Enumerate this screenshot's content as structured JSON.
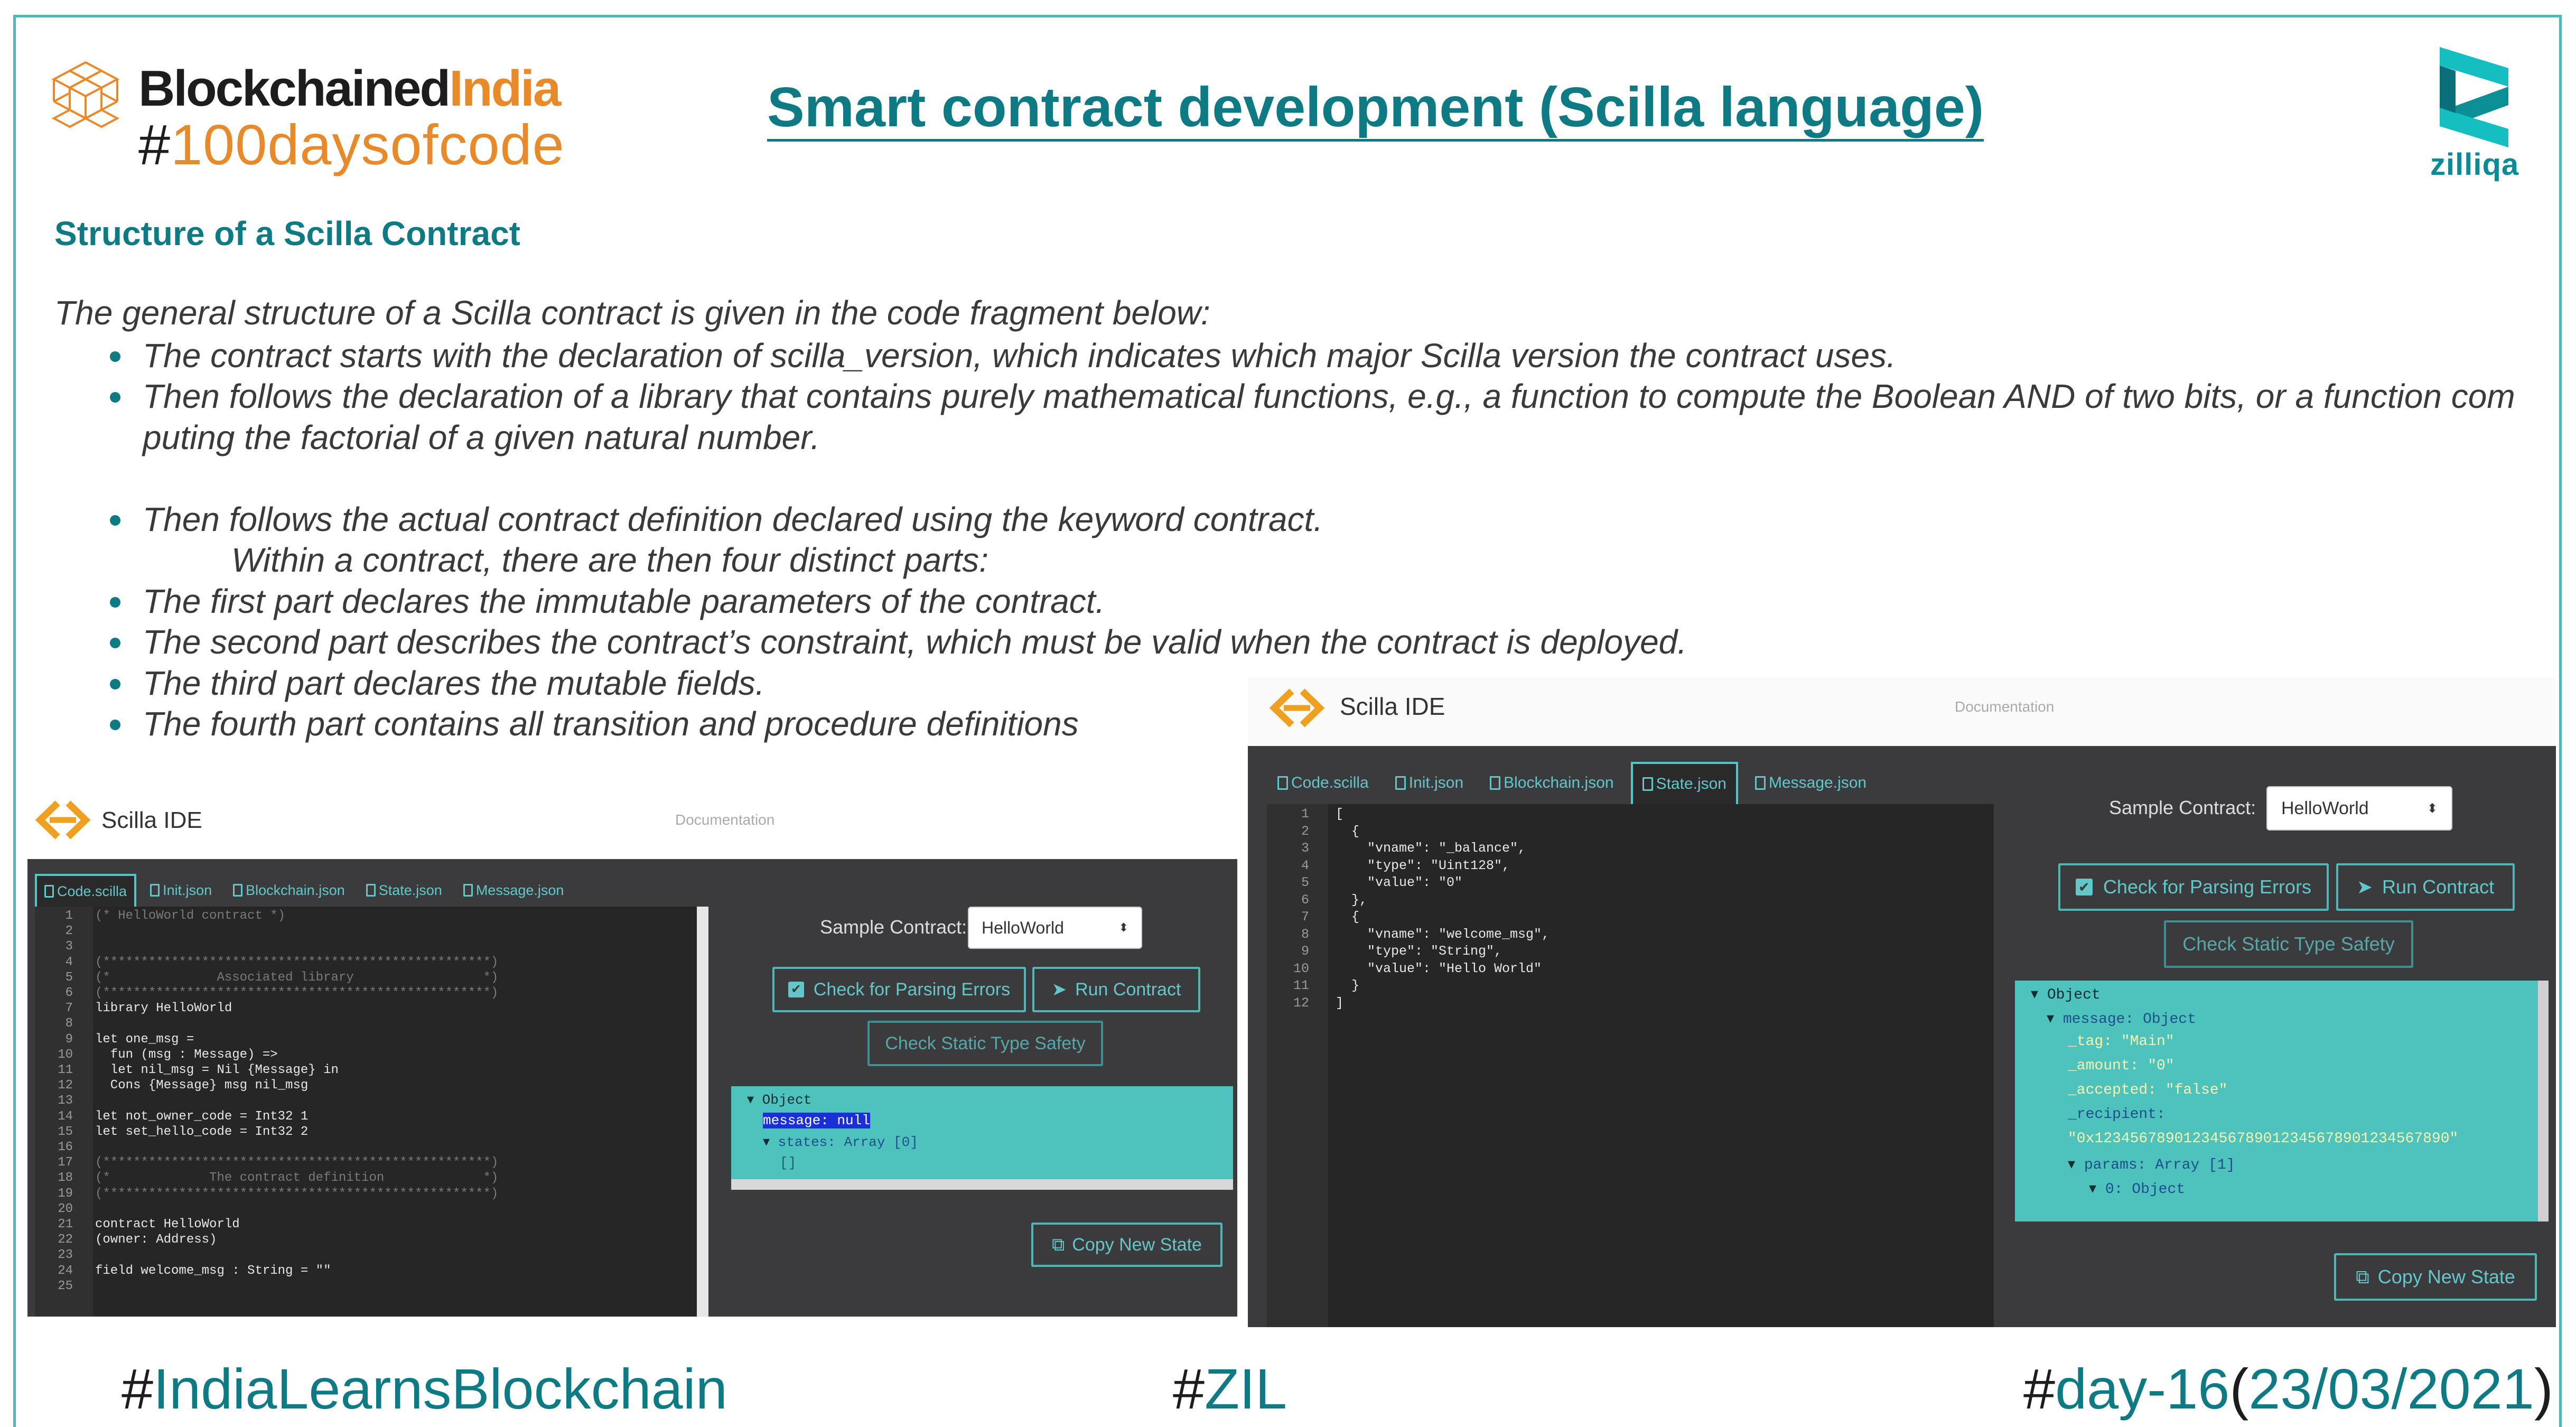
{
  "header": {
    "brand_name_dark": "Blockchained",
    "brand_name_accent": "India",
    "brand_hashtag_symbol": "#",
    "brand_hashtag_text": "100daysofcode",
    "title": "Smart contract development (Scilla language)",
    "partner_logo_text": "zilliqa"
  },
  "content": {
    "section_title": "Structure of a Scilla Contract",
    "intro": "The general structure of a Scilla contract is given in the code fragment below:",
    "bullets": [
      {
        "text": "The contract starts with the declaration of scilla_version, which indicates which major Scilla version the contract uses.",
        "bullet": true
      },
      {
        "text": "Then follows the declaration of a library that contains purely mathematical functions, e.g., a function to compute the Boolean AND of two bits, or a function com",
        "bullet": true
      },
      {
        "text": "puting the factorial of a given natural number.",
        "bullet": false
      },
      {
        "text": "Then follows the actual contract definition declared using the keyword contract.",
        "bullet": true
      },
      {
        "text": "Within a contract, there are then four distinct parts:",
        "bullet": false
      },
      {
        "text": "The first part declares the immutable parameters of the contract.",
        "bullet": true
      },
      {
        "text": "The second part describes the contract’s constraint, which must be valid when the contract is deployed.",
        "bullet": true
      },
      {
        "text": "The third part declares the mutable fields.",
        "bullet": true
      },
      {
        "text": "The fourth part contains all transition and procedure definitions",
        "bullet": true
      }
    ]
  },
  "ide_left": {
    "app_name": "Scilla IDE",
    "doc_link": "Documentation",
    "tabs": [
      "Code.scilla",
      "Init.json",
      "Blockchain.json",
      "State.json",
      "Message.json"
    ],
    "active_tab": "Code.scilla",
    "sample_label": "Sample Contract:",
    "sample_value": "HelloWorld",
    "btn_check": "Check for Parsing Errors",
    "btn_run": "Run Contract",
    "btn_static": "Check Static Type Safety",
    "btn_copy": "Copy New State",
    "line_numbers": [
      "1",
      "2",
      "3",
      "4",
      "5",
      "6",
      "7",
      "8",
      "9",
      "10",
      "11",
      "12",
      "13",
      "14",
      "15",
      "16",
      "17",
      "18",
      "19",
      "20",
      "21",
      "22",
      "23",
      "24",
      "25"
    ],
    "code": [
      "(* HelloWorld contract *)",
      "",
      "",
      "(***************************************************)",
      "(*              Associated library                 *)",
      "(***************************************************)",
      "library HelloWorld",
      "",
      "let one_msg =",
      "  fun (msg : Message) =>",
      "  let nil_msg = Nil {Message} in",
      "  Cons {Message} msg nil_msg",
      "",
      "let not_owner_code = Int32 1",
      "let set_hello_code = Int32 2",
      "",
      "(***************************************************)",
      "(*             The contract definition             *)",
      "(***************************************************)",
      "",
      "contract HelloWorld",
      "(owner: Address)",
      "",
      "field welcome_msg : String = \"\"",
      ""
    ],
    "state": [
      "Object",
      "message: null",
      "states: Array [0]",
      "[]"
    ]
  },
  "ide_right": {
    "app_name": "Scilla IDE",
    "doc_link": "Documentation",
    "tabs": [
      "Code.scilla",
      "Init.json",
      "Blockchain.json",
      "State.json",
      "Message.json"
    ],
    "active_tab": "State.json",
    "sample_label": "Sample Contract:",
    "sample_value": "HelloWorld",
    "btn_check": "Check for Parsing Errors",
    "btn_run": "Run Contract",
    "btn_static": "Check Static Type Safety",
    "btn_copy": "Copy New State",
    "line_numbers": [
      "1",
      "2",
      "3",
      "4",
      "5",
      "6",
      "7",
      "8",
      "9",
      "10",
      "11",
      "12"
    ],
    "code": [
      "[",
      "  {",
      "    \"vname\": \"_balance\",",
      "    \"type\": \"Uint128\",",
      "    \"value\": \"0\"",
      "  },",
      "  {",
      "    \"vname\": \"welcome_msg\",",
      "    \"type\": \"String\",",
      "    \"value\": \"Hello World\"",
      "  }",
      "]"
    ],
    "state": [
      "Object",
      "message: Object",
      "_tag: \"Main\"",
      "_amount: \"0\"",
      "_accepted: \"false\"",
      "_recipient:",
      "\"0x1234567890123456789012345678901234567890\"",
      "params: Array [1]",
      "0: Object"
    ]
  },
  "footer": {
    "hash1": "#",
    "tag1": "IndiaLearnsBlockchain",
    "hash2": "#",
    "tag2": "ZIL",
    "hash3": "#",
    "tag3": "day-16",
    "paren_open": "(",
    "date": "23/03/2021",
    "paren_close": ")"
  },
  "colors": {
    "teal": "#0e7a84",
    "orange": "#e8892a",
    "ide_accent": "#4ec3bd"
  }
}
